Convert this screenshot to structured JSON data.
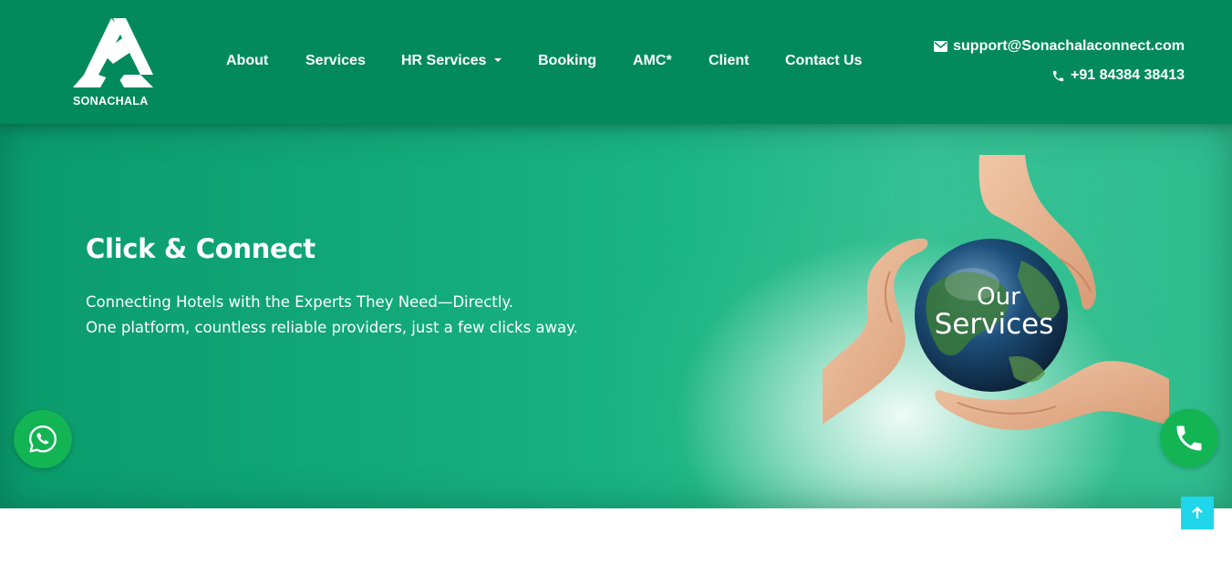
{
  "brand": {
    "logo_text": "SONACHALA",
    "colors": {
      "header_bg": "#028a5d",
      "hero_green": "#1bb583",
      "whatsapp_green": "#13b454",
      "scroll_top": "#1fd6ea"
    }
  },
  "nav": {
    "items": [
      {
        "label": "About"
      },
      {
        "label": "Services"
      },
      {
        "label": "HR Services",
        "has_dropdown": true
      },
      {
        "label": "Booking"
      },
      {
        "label": "AMC*"
      },
      {
        "label": "Client"
      },
      {
        "label": "Contact Us"
      }
    ]
  },
  "contact": {
    "email": "support@Sonachalaconnect.com",
    "email_icon": "envelope-icon",
    "phone": "+91 84384 38413",
    "phone_icon": "phone-icon"
  },
  "hero": {
    "title": "Click & Connect",
    "subtitle_line1": "Connecting Hotels with the Experts They Need—Directly.",
    "subtitle_line2": "One platform, countless reliable providers, just a few clicks away.",
    "image_text_line1": "Our",
    "image_text_line2": "Services"
  },
  "floating": {
    "whatsapp_icon": "whatsapp-icon",
    "call_icon": "phone-icon",
    "scroll_top_icon": "arrow-up-icon"
  }
}
